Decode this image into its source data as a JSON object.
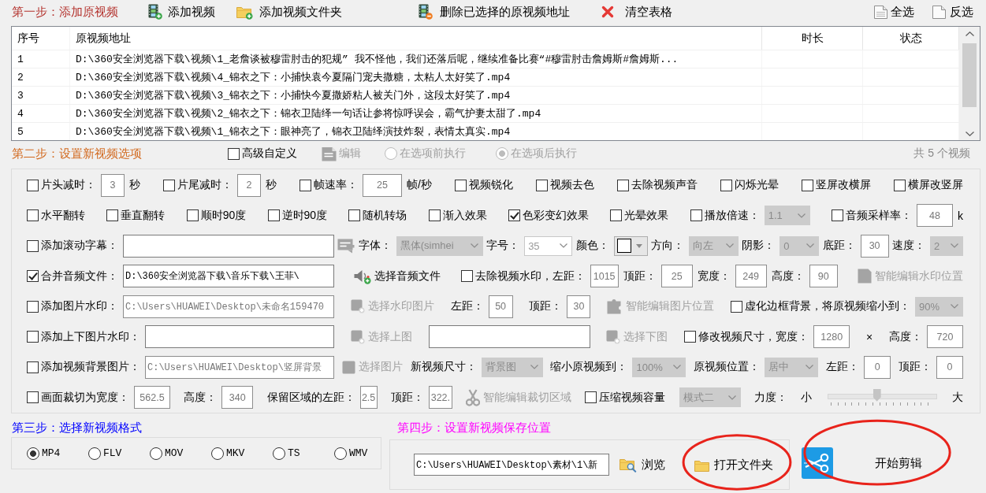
{
  "step1": {
    "title": "第一步：添加原视频",
    "actions": [
      {
        "label": "添加视频"
      },
      {
        "label": "添加视频文件夹"
      },
      {
        "label": "删除已选择的原视频地址"
      },
      {
        "label": "清空表格"
      }
    ],
    "selection": [
      {
        "label": "全选"
      },
      {
        "label": "反选"
      }
    ]
  },
  "table": {
    "columns": [
      "序号",
      "原视频地址",
      "时长",
      "状态"
    ],
    "rows": [
      {
        "index": "1",
        "path": "D:\\360安全浏览器下载\\视频\\1_老詹谈被穆雷肘击的犯规” 我不怪他，我们还落后呢，继续准备比赛“#穆雷肘击詹姆斯#詹姆斯..."
      },
      {
        "index": "2",
        "path": "D:\\360安全浏览器下载\\视频\\4_锦衣之下：小捕快袁今夏隔门宠夫撒糖，太粘人太好笑了.mp4"
      },
      {
        "index": "3",
        "path": "D:\\360安全浏览器下载\\视频\\3_锦衣之下：小捕快今夏撒娇粘人被关门外，这段太好笑了.mp4"
      },
      {
        "index": "4",
        "path": "D:\\360安全浏览器下载\\视频\\2_锦衣之下：锦衣卫陆绎一句话让参将惊呼误会，霸气护妻太甜了.mp4"
      },
      {
        "index": "5",
        "path": "D:\\360安全浏览器下载\\视频\\1_锦衣之下：眼神亮了，锦衣卫陆绎演技炸裂，表情太真实.mp4"
      }
    ]
  },
  "step2": {
    "title": "第二步：设置新视频选项",
    "advanced": {
      "label": "高级自定义",
      "checked": false
    },
    "edit": {
      "label": "编辑",
      "disabled": true
    },
    "run_modes": [
      {
        "label": "在选项前执行",
        "selected": false,
        "disabled": true
      },
      {
        "label": "在选项后执行",
        "selected": true,
        "disabled": true
      }
    ],
    "count": "共 5 个视频"
  },
  "options": {
    "rows": [
      {
        "groups": [
          {
            "items": [
              {
                "kind": "checkbox",
                "label": "片头减时：",
                "checked": false
              },
              {
                "kind": "input",
                "value": "3",
                "disabled": true
              },
              {
                "kind": "label",
                "text": "秒"
              }
            ]
          },
          {
            "items": [
              {
                "kind": "checkbox",
                "label": "片尾减时：",
                "checked": false
              },
              {
                "kind": "input",
                "value": "2",
                "disabled": true
              },
              {
                "kind": "label",
                "text": "秒"
              }
            ]
          },
          {
            "items": [
              {
                "kind": "checkbox",
                "label": "帧速率：",
                "checked": false
              },
              {
                "kind": "input",
                "value": "25",
                "disabled": true
              },
              {
                "kind": "label",
                "text": "帧/秒"
              }
            ]
          },
          {
            "items": [
              {
                "kind": "checkbox",
                "label": "视频锐化",
                "checked": false
              }
            ]
          },
          {
            "items": [
              {
                "kind": "checkbox",
                "label": "视频去色",
                "checked": false
              }
            ]
          },
          {
            "items": [
              {
                "kind": "checkbox",
                "label": "去除视频声音",
                "checked": false
              }
            ]
          },
          {
            "items": [
              {
                "kind": "checkbox",
                "label": "闪烁光晕",
                "checked": false
              }
            ]
          },
          {
            "items": [
              {
                "kind": "checkbox",
                "label": "竖屏改横屏",
                "checked": false
              }
            ]
          },
          {
            "items": [
              {
                "kind": "checkbox",
                "label": "横屏改竖屏",
                "checked": false
              }
            ]
          }
        ]
      },
      {
        "groups": [
          {
            "items": [
              {
                "kind": "checkbox",
                "label": "水平翻转",
                "checked": false
              }
            ]
          },
          {
            "items": [
              {
                "kind": "checkbox",
                "label": "垂直翻转",
                "checked": false
              }
            ]
          },
          {
            "items": [
              {
                "kind": "checkbox",
                "label": "顺时90度",
                "checked": false
              }
            ]
          },
          {
            "items": [
              {
                "kind": "checkbox",
                "label": "逆时90度",
                "checked": false
              }
            ]
          },
          {
            "items": [
              {
                "kind": "checkbox",
                "label": "随机转场",
                "checked": false
              }
            ]
          },
          {
            "items": [
              {
                "kind": "checkbox",
                "label": "渐入效果",
                "checked": false
              }
            ]
          },
          {
            "items": [
              {
                "kind": "checkbox",
                "label": "色彩变幻效果",
                "checked": true
              }
            ]
          },
          {
            "items": [
              {
                "kind": "checkbox",
                "label": "光晕效果",
                "checked": false
              }
            ]
          },
          {
            "items": [
              {
                "kind": "checkbox",
                "label": "播放倍速：",
                "checked": false
              },
              {
                "kind": "select",
                "value": "1.1",
                "disabled": true
              }
            ]
          },
          {
            "items": [
              {
                "kind": "checkbox",
                "label": "音频采样率：",
                "checked": false
              },
              {
                "kind": "input",
                "value": "48",
                "disabled": true
              },
              {
                "kind": "label",
                "text": "k"
              }
            ]
          }
        ]
      },
      {
        "groups": [
          {
            "items": [
              {
                "kind": "checkbox",
                "label": "添加滚动字幕：",
                "checked": false
              },
              {
                "kind": "input"
              }
            ]
          },
          {
            "items": [
              {
                "kind": "button",
                "disabled": true
              }
            ]
          },
          {
            "items": [
              {
                "kind": "label",
                "text": "字体："
              },
              {
                "kind": "select",
                "value": "黑体(simhei",
                "disabled": true
              }
            ]
          },
          {
            "items": [
              {
                "kind": "label",
                "text": "字号："
              },
              {
                "kind": "combo",
                "value": "35",
                "disabled": true
              }
            ]
          },
          {
            "items": [
              {
                "kind": "label",
                "text": "颜色："
              },
              {
                "kind": "color",
                "color": "#ffffff"
              }
            ]
          },
          {
            "items": [
              {
                "kind": "label",
                "text": "方向："
              },
              {
                "kind": "select",
                "value": "向左",
                "disabled": true
              }
            ]
          },
          {
            "items": [
              {
                "kind": "label",
                "text": "阴影："
              },
              {
                "kind": "select",
                "value": "0",
                "disabled": true
              }
            ]
          },
          {
            "items": [
              {
                "kind": "label",
                "text": "底距："
              },
              {
                "kind": "input",
                "value": "30",
                "disabled": true
              }
            ]
          },
          {
            "items": [
              {
                "kind": "label",
                "text": "速度："
              },
              {
                "kind": "select",
                "value": "2",
                "disabled": true
              }
            ]
          }
        ]
      },
      {
        "groups": [
          {
            "items": [
              {
                "kind": "checkbox",
                "label": "合并音频文件：",
                "checked": true
              },
              {
                "kind": "input",
                "value": "D:\\360安全浏览器下载\\音乐下载\\王菲\\",
                "disabled": false
              }
            ]
          },
          {
            "items": [
              {
                "kind": "button",
                "label": "选择音频文件",
                "disabled": false
              }
            ]
          },
          {
            "items": [
              {
                "kind": "checkbox",
                "label": "去除视频水印，左距：",
                "checked": false
              },
              {
                "kind": "input",
                "value": "1015",
                "disabled": true
              },
              {
                "kind": "label",
                "text": "顶距："
              },
              {
                "kind": "input",
                "value": "25",
                "disabled": true
              },
              {
                "kind": "label",
                "text": "宽度："
              },
              {
                "kind": "input",
                "value": "249",
                "disabled": true
              },
              {
                "kind": "label",
                "text": "高度："
              },
              {
                "kind": "input",
                "value": "90",
                "disabled": true
              }
            ]
          },
          {
            "items": [
              {
                "kind": "button",
                "label": "智能编辑水印位置",
                "disabled": true
              }
            ]
          }
        ]
      },
      {
        "groups": [
          {
            "items": [
              {
                "kind": "checkbox",
                "label": "添加图片水印：",
                "checked": false
              },
              {
                "kind": "input",
                "value": "C:\\Users\\HUAWEI\\Desktop\\未命名159470",
                "disabled": true
              }
            ]
          },
          {
            "items": [
              {
                "kind": "button",
                "label": "选择水印图片",
                "disabled": true
              }
            ]
          },
          {
            "items": [
              {
                "kind": "label",
                "text": "左距："
              },
              {
                "kind": "input",
                "value": "50",
                "disabled": true
              }
            ]
          },
          {
            "items": [
              {
                "kind": "label",
                "text": "顶距："
              },
              {
                "kind": "input",
                "value": "30",
                "disabled": true
              }
            ]
          },
          {
            "items": [
              {
                "kind": "button",
                "label": "智能编辑图片位置",
                "disabled": true
              }
            ]
          },
          {
            "items": [
              {
                "kind": "checkbox",
                "label": "虚化边框背景，将原视频缩小到：",
                "checked": false
              },
              {
                "kind": "select",
                "value": "90%",
                "disabled": true
              }
            ]
          }
        ]
      },
      {
        "groups": [
          {
            "items": [
              {
                "kind": "checkbox",
                "label": "添加上下图片水印：",
                "checked": false
              },
              {
                "kind": "input"
              }
            ]
          },
          {
            "items": [
              {
                "kind": "button",
                "label": "选择上图",
                "disabled": true
              }
            ]
          },
          {
            "items": [
              {
                "kind": "input"
              }
            ]
          },
          {
            "items": [
              {
                "kind": "button",
                "label": "选择下图",
                "disabled": true
              }
            ]
          },
          {
            "items": [
              {
                "kind": "checkbox",
                "label": "修改视频尺寸，宽度：",
                "checked": false
              },
              {
                "kind": "input",
                "value": "1280",
                "disabled": true
              }
            ]
          },
          {
            "items": [
              {
                "kind": "label",
                "text": "×"
              }
            ]
          },
          {
            "items": [
              {
                "kind": "label",
                "text": "高度："
              },
              {
                "kind": "input",
                "value": "720",
                "disabled": true
              }
            ]
          }
        ]
      },
      {
        "groups": [
          {
            "items": [
              {
                "kind": "checkbox",
                "label": "添加视频背景图片：",
                "checked": false
              },
              {
                "kind": "input",
                "value": "C:\\Users\\HUAWEI\\Desktop\\竖屏背景",
                "disabled": true
              }
            ]
          },
          {
            "items": [
              {
                "kind": "button",
                "label": "选择图片",
                "disabled": true
              }
            ]
          },
          {
            "items": [
              {
                "kind": "label",
                "text": "新视频尺寸："
              },
              {
                "kind": "select",
                "value": "背景图",
                "disabled": true
              }
            ]
          },
          {
            "items": [
              {
                "kind": "label",
                "text": "缩小原视频到："
              },
              {
                "kind": "select",
                "value": "100%",
                "disabled": true
              }
            ]
          },
          {
            "items": [
              {
                "kind": "label",
                "text": "原视频位置："
              },
              {
                "kind": "select",
                "value": "居中",
                "disabled": true
              }
            ]
          },
          {
            "items": [
              {
                "kind": "label",
                "text": "左距："
              },
              {
                "kind": "input",
                "value": "0",
                "disabled": true
              }
            ]
          },
          {
            "items": [
              {
                "kind": "label",
                "text": "顶距："
              },
              {
                "kind": "input",
                "value": "0",
                "disabled": true
              }
            ]
          }
        ]
      },
      {
        "groups": [
          {
            "items": [
              {
                "kind": "checkbox",
                "label": "画面裁切为宽度：",
                "checked": false
              },
              {
                "kind": "input",
                "value": "562.5",
                "disabled": true
              }
            ]
          },
          {
            "items": [
              {
                "kind": "label",
                "text": "高度："
              },
              {
                "kind": "input",
                "value": "340",
                "disabled": true
              }
            ]
          },
          {
            "items": [
              {
                "kind": "label",
                "text": "保留区域的左距："
              },
              {
                "kind": "input",
                "value": "2.5",
                "disabled": true
              }
            ]
          },
          {
            "items": [
              {
                "kind": "label",
                "text": "顶距："
              },
              {
                "kind": "input",
                "value": "322.",
                "disabled": true
              }
            ]
          },
          {
            "items": [
              {
                "kind": "button",
                "label": "智能编辑裁切区域",
                "disabled": true
              }
            ]
          },
          {
            "items": [
              {
                "kind": "checkbox",
                "label": "压缩视频容量",
                "checked": false
              }
            ]
          },
          {
            "items": [
              {
                "kind": "select",
                "value": "模式二",
                "disabled": true
              }
            ]
          },
          {
            "items": [
              {
                "kind": "label",
                "text": "力度："
              }
            ]
          },
          {
            "items": [
              {
                "kind": "label",
                "text": "小"
              }
            ]
          },
          {
            "items": [
              {
                "kind": "slider",
                "level": 0.45
              }
            ]
          },
          {
            "items": [
              {
                "kind": "label",
                "text": "大"
              }
            ]
          }
        ]
      }
    ]
  },
  "step3": {
    "title": "第三步：选择新视频格式",
    "formats": [
      {
        "label": "MP4",
        "selected": true
      },
      {
        "label": "FLV",
        "selected": false
      },
      {
        "label": "MOV",
        "selected": false
      },
      {
        "label": "MKV",
        "selected": false
      },
      {
        "label": "TS",
        "selected": false
      },
      {
        "label": "WMV",
        "selected": false
      }
    ]
  },
  "step4": {
    "title": "第四步：设置新视频保存位置",
    "path": "C:\\Users\\HUAWEI\\Desktop\\素材\\1\\新",
    "buttons": [
      {
        "label": "浏览",
        "circled": false
      },
      {
        "label": "打开文件夹",
        "circled": true
      }
    ],
    "start": {
      "label": "开始剪辑",
      "circled": true
    }
  }
}
